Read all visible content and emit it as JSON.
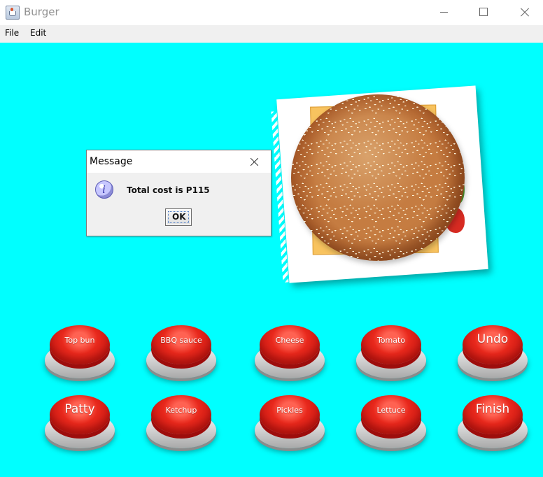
{
  "window": {
    "title": "Burger",
    "controls": {
      "minimize_icon": "minimize-icon",
      "maximize_icon": "maximize-icon",
      "close_icon": "close-icon"
    }
  },
  "menu": {
    "items": [
      {
        "label": "File"
      },
      {
        "label": "Edit"
      }
    ]
  },
  "background": {
    "color": "#00ffff"
  },
  "dialog": {
    "title": "Message",
    "message": "Total cost is P115",
    "button": "OK",
    "icon": "info-icon"
  },
  "buttons": [
    {
      "label": "Top bun"
    },
    {
      "label": "BBQ sauce"
    },
    {
      "label": "Cheese"
    },
    {
      "label": "Tomato"
    },
    {
      "label": "Undo"
    },
    {
      "label": "Patty"
    },
    {
      "label": "Ketchup"
    },
    {
      "label": "Pickles"
    },
    {
      "label": "Lettuce"
    },
    {
      "label": "Finish"
    }
  ]
}
